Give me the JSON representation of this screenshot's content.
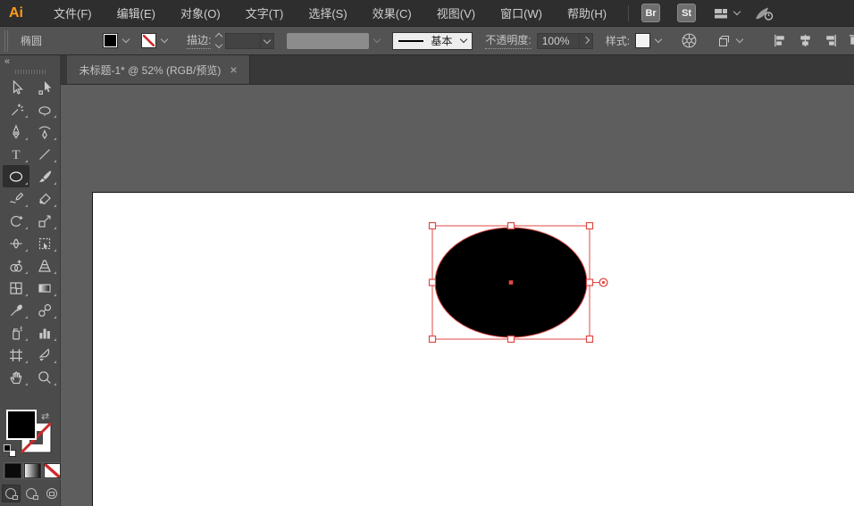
{
  "app": {
    "logo_text": "Ai"
  },
  "menubar": {
    "items": [
      "文件(F)",
      "编辑(E)",
      "对象(O)",
      "文字(T)",
      "选择(S)",
      "效果(C)",
      "视图(V)",
      "窗口(W)",
      "帮助(H)"
    ],
    "bridge_label": "Br",
    "stock_label": "St"
  },
  "controlbar": {
    "context_label": "椭圆",
    "stroke_label": "描边:",
    "profile_value": "基本",
    "opacity_label": "不透明度:",
    "opacity_value": "100%",
    "style_label": "样式:"
  },
  "tabbar": {
    "active_tab_title": "未标题-1* @ 52% (RGB/预览)",
    "close_glyph": "×"
  },
  "toolbar": {
    "collapse_glyph": "«",
    "swap_glyph": "⇄",
    "active_tool": "ellipse",
    "tools": [
      "selection",
      "direct-selection",
      "magic-wand",
      "lasso",
      "pen",
      "curvature",
      "type",
      "line-segment",
      "ellipse",
      "paintbrush",
      "shaper",
      "eraser",
      "rotate",
      "scale",
      "width",
      "free-transform",
      "shape-builder",
      "perspective-grid",
      "mesh",
      "gradient",
      "eyedropper",
      "blend",
      "symbol-sprayer",
      "column-graph",
      "artboard",
      "slice",
      "hand",
      "zoom"
    ]
  },
  "fill_stroke": {
    "fill_color": "#000000",
    "stroke": "none"
  },
  "colors": {
    "selection": "#E04A45",
    "artboard": "#FFFFFF",
    "logo_accent": "#FF9A1E"
  },
  "artboard": {
    "zoom_percent": "52%",
    "color_mode": "RGB/预览",
    "shape": {
      "type": "ellipse",
      "fill": "#000000",
      "selected": true
    }
  }
}
